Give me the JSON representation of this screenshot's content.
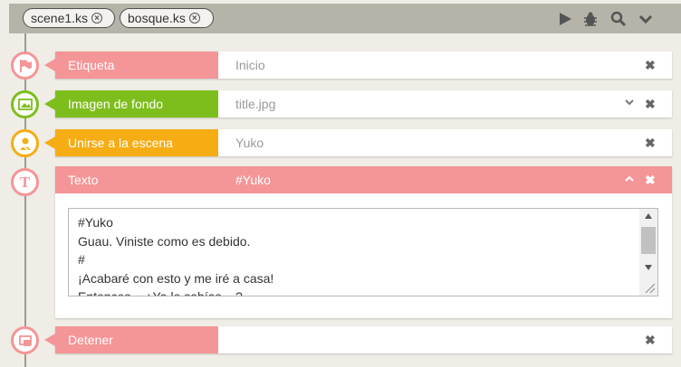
{
  "tabs": [
    {
      "label": "scene1.ks",
      "close": "⊗"
    },
    {
      "label": "bosque.ks",
      "close": "⊗"
    }
  ],
  "toolbar": {
    "icons": [
      "play-icon",
      "bug-icon",
      "search-icon",
      "chevron-down-icon"
    ]
  },
  "rows": [
    {
      "label": "Etiqueta",
      "value": "Inicio",
      "color": "#f49597"
    },
    {
      "label": "Imagen de fondo",
      "value": "title.jpg",
      "color": "#7dbe1c"
    },
    {
      "label": "Unirse a la escena",
      "value": "Yuko",
      "color": "#f6ad14"
    }
  ],
  "texto": {
    "label": "Texto",
    "value": "#Yuko",
    "color": "#f49597",
    "lines": [
      "#Yuko",
      "Guau. Viniste como es debido.",
      "#",
      "¡Acabaré con esto y me iré a casa!",
      "Entonces... ¿Ya lo sabías... ?"
    ]
  },
  "detener": {
    "label": "Detener",
    "value": "",
    "color": "#f49597"
  },
  "icons": {
    "close": "✖",
    "expand": "⌄",
    "collapse": "⌃"
  }
}
